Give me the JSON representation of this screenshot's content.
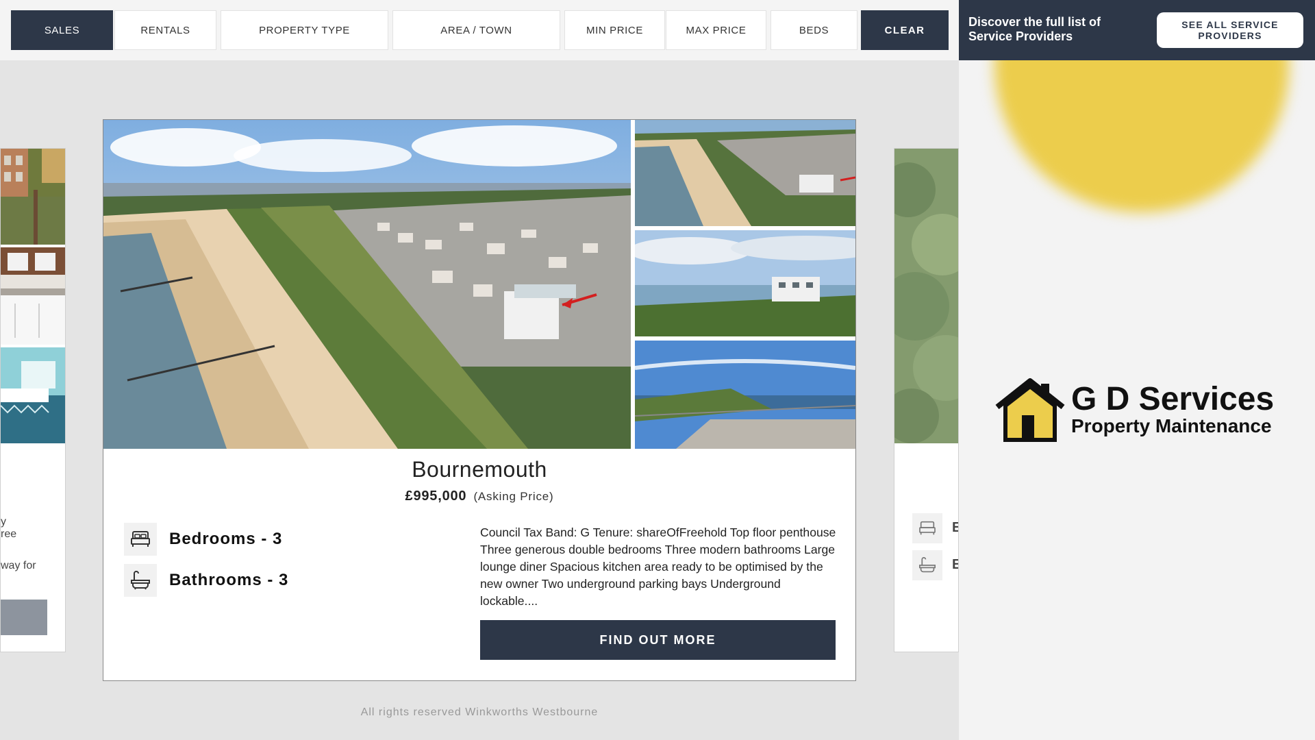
{
  "filters": {
    "sales": "Sales",
    "rentals": "Rentals",
    "property_type": "Property Type",
    "area_town": "Area / Town",
    "min_price": "Min Price",
    "max_price": "Max Price",
    "beds": "Beds",
    "clear": "Clear"
  },
  "listing": {
    "town": "Bournemouth",
    "price": "£995,000",
    "price_qualifier": "(Asking Price)",
    "bedrooms": "Bedrooms - 3",
    "bathrooms": "Bathrooms - 3",
    "description": "Council Tax Band: G Tenure: shareOfFreehold Top floor penthouse Three generous double bedrooms Three modern bathrooms Large lounge diner Spacious kitchen area ready to be optimised by the new owner Two underground parking bays Underground lockable....",
    "cta": "Find Out More"
  },
  "left_peek": {
    "line1": "y",
    "line2": "ree",
    "line3": "way for"
  },
  "right_peek": {
    "letter1": "E",
    "letter2": "E"
  },
  "footer": "All rights reserved Winkworths Westbourne",
  "promo": {
    "text": "Discover the full list of Service Providers",
    "button": "See All Service Providers"
  },
  "logo": {
    "title": "G D Services",
    "subtitle": "Property Maintenance"
  },
  "colors": {
    "navy": "#2d3748",
    "accent_yellow": "#eccd4c"
  },
  "icons": {
    "bed": "bed-icon",
    "bath": "bath-icon"
  }
}
